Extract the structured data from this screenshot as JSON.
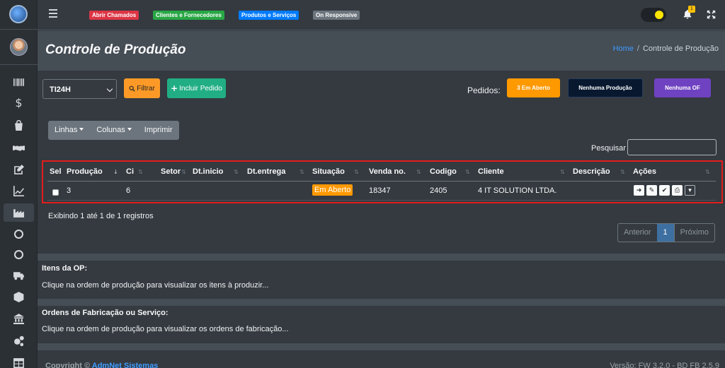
{
  "topbar": {
    "pills": [
      {
        "label": "Abrir Chamados",
        "color": "#dc3545"
      },
      {
        "label": "Clientes e Fornecedores",
        "color": "#28a745"
      },
      {
        "label": "Produtos e Serviços",
        "color": "#007bff"
      },
      {
        "label": "On Responsive",
        "color": "#6c757d"
      }
    ],
    "notification_count": "1"
  },
  "sidebar": {
    "items": [
      "barcode-icon",
      "dollar-icon",
      "shopping-bag-icon",
      "handshake-icon",
      "edit-icon",
      "chart-line-icon",
      "industry-icon",
      "circle-icon",
      "circle-icon",
      "truck-icon",
      "box-icon",
      "bank-icon",
      "cogs-icon",
      "table-icon"
    ],
    "active_item": "industry-icon"
  },
  "header": {
    "title": "Controle de Produção",
    "breadcrumb_home": "Home",
    "breadcrumb_separator": "/",
    "breadcrumb_current": "Controle de Produção"
  },
  "controls": {
    "select_value": "TI24H",
    "filter_label": "Filtrar",
    "add_label": "Incluir Pedido",
    "pedidos_label": "Pedidos:",
    "status_buttons": [
      {
        "label": "3 Em Aberto",
        "color": "#ff9900"
      },
      {
        "label": "Nenhuma Produção",
        "color": "#07182f"
      },
      {
        "label": "Nenhuma OF",
        "color": "#6f42c1"
      }
    ],
    "group_buttons": [
      "Linhas",
      "Colunas",
      "Imprimir"
    ],
    "search_label": "Pesquisar",
    "search_value": ""
  },
  "table": {
    "headers": [
      "Sel",
      "Produção",
      "Ci",
      "Setor",
      "Dt.inicio",
      "Dt.entrega",
      "Situação",
      "Venda no.",
      "Codigo",
      "Cliente",
      "Descrição",
      "Ações"
    ],
    "rows": [
      {
        "producao": "3",
        "ci": "6",
        "setor": "",
        "dt_inicio": "",
        "dt_entrega": "",
        "situacao": "Em Aberto",
        "venda": "18347",
        "codigo": "2405",
        "cliente": "4 IT SOLUTION LTDA.",
        "descricao": ""
      }
    ]
  },
  "pagination": {
    "records_text": "Exibindo 1 até 1 de 1 registros",
    "prev": "Anterior",
    "current": "1",
    "next": "Próximo"
  },
  "sections": {
    "itens_title": "Itens da OP:",
    "itens_text": "Clique na ordem de produção para visualizar os itens à produzir...",
    "ordens_title": "Ordens de Fabricação ou Serviço:",
    "ordens_text": "Clique na ordem de produção para visualizar os ordens de fabricação..."
  },
  "footer": {
    "copyright_prefix": "Copyright ©",
    "copyright_link": "AdmNet Sistemas",
    "version_text": "Versão: FW 3.2.0 - BD FB 2.5.9"
  }
}
